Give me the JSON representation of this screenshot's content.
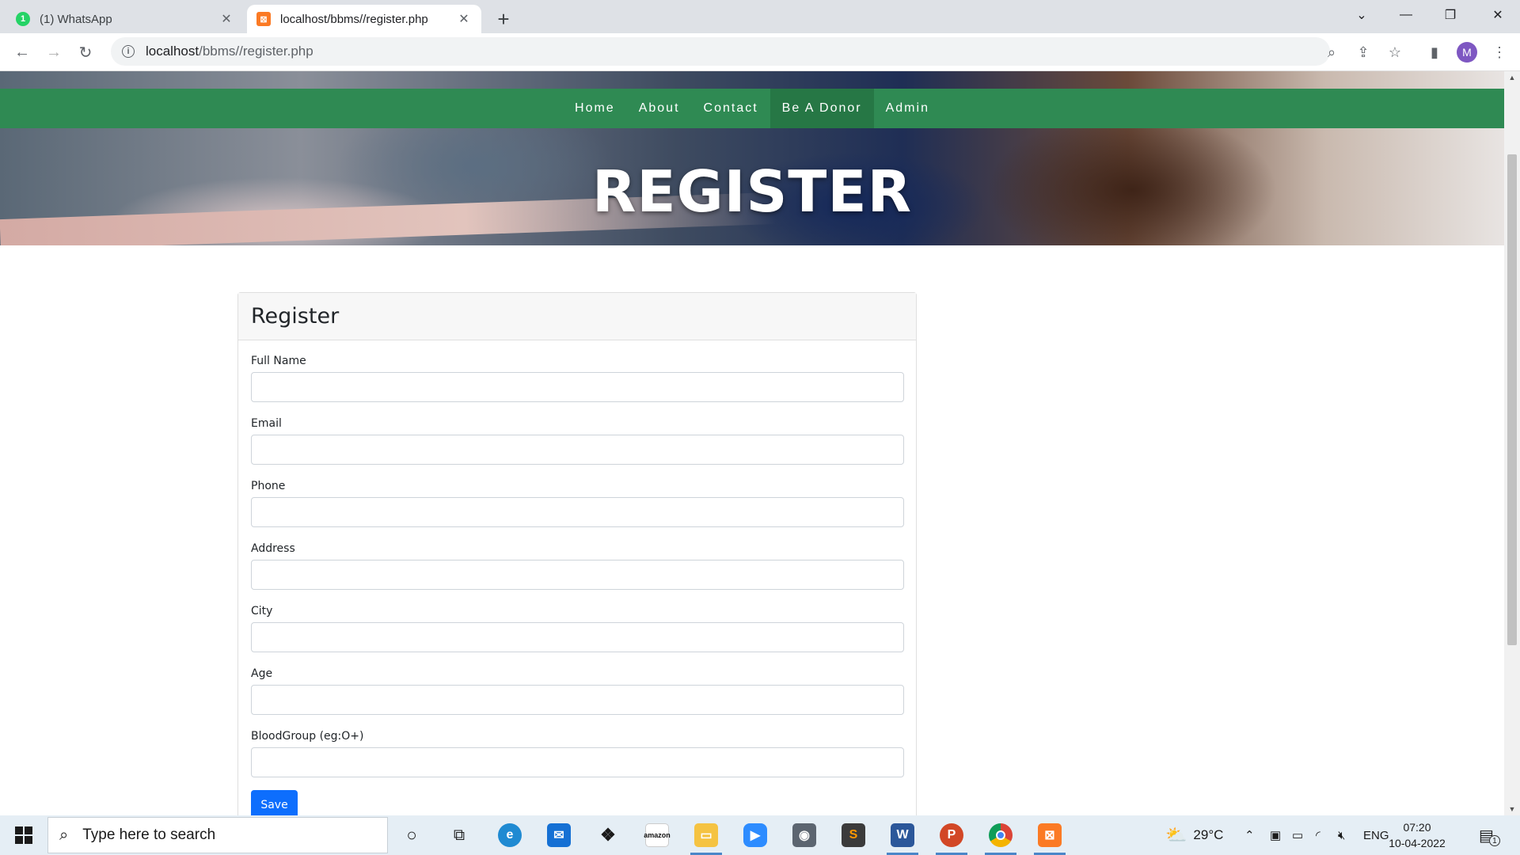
{
  "browser": {
    "tabs": [
      {
        "title": "(1) WhatsApp",
        "favicon": "whatsapp-icon"
      },
      {
        "title": "localhost/bbms//register.php",
        "favicon": "xampp-icon"
      }
    ],
    "url_host": "localhost",
    "url_path": "/bbms//register.php",
    "profile_initial": "M"
  },
  "site": {
    "nav": [
      {
        "label": "Home"
      },
      {
        "label": "About"
      },
      {
        "label": "Contact"
      },
      {
        "label": "Be A Donor",
        "active": true
      },
      {
        "label": "Admin"
      }
    ],
    "hero_title": "REGISTER",
    "accent_color": "#2f8a53"
  },
  "form": {
    "title": "Register",
    "fields": [
      {
        "label": "Full Name",
        "value": ""
      },
      {
        "label": "Email",
        "value": ""
      },
      {
        "label": "Phone",
        "value": ""
      },
      {
        "label": "Address",
        "value": ""
      },
      {
        "label": "City",
        "value": ""
      },
      {
        "label": "Age",
        "value": ""
      },
      {
        "label": "BloodGroup (eg:O+)",
        "value": ""
      }
    ],
    "submit_label": "Save"
  },
  "taskbar": {
    "search_placeholder": "Type here to search",
    "weather": "29°C",
    "language": "ENG",
    "time": "07:20",
    "date": "10-04-2022",
    "notifications": "1"
  }
}
